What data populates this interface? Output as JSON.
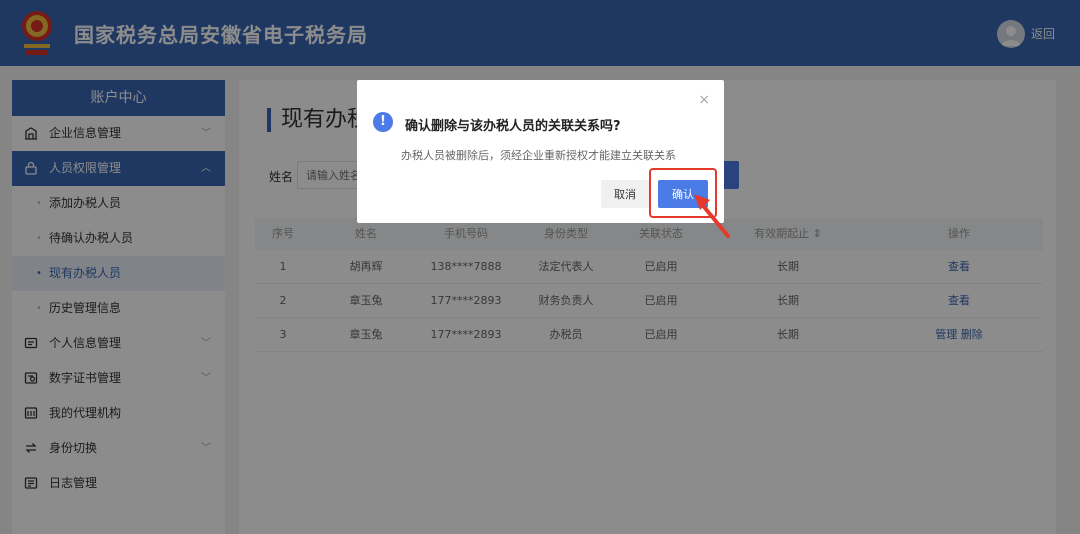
{
  "header": {
    "title": "国家税务总局安徽省电子税务局",
    "back_label": "返回"
  },
  "sidebar": {
    "title": "账户中心",
    "items": [
      {
        "label": "企业信息管理",
        "icon": "building-icon",
        "chevron": "﹀"
      },
      {
        "label": "人员权限管理",
        "icon": "lock-icon",
        "chevron": "︿"
      },
      {
        "label": "添加办税人员"
      },
      {
        "label": "待确认办税人员"
      },
      {
        "label": "现有办税人员"
      },
      {
        "label": "历史管理信息"
      },
      {
        "label": "个人信息管理",
        "icon": "id-card-icon",
        "chevron": "﹀"
      },
      {
        "label": "数字证书管理",
        "icon": "certificate-icon",
        "chevron": "﹀"
      },
      {
        "label": "我的代理机构",
        "icon": "agency-icon"
      },
      {
        "label": "身份切换",
        "icon": "switch-icon",
        "chevron": "﹀"
      },
      {
        "label": "日志管理",
        "icon": "log-icon"
      }
    ]
  },
  "main": {
    "title": "现有办税人员",
    "filter_label": "姓名",
    "filter_placeholder": "请输入姓名",
    "table": {
      "headers": [
        "序号",
        "姓名",
        "手机号码",
        "身份类型",
        "关联状态",
        "有效期起止 ⇕",
        "操作"
      ],
      "rows": [
        {
          "no": "1",
          "name": "胡再辉",
          "phone": "138****7888",
          "role": "法定代表人",
          "status": "已启用",
          "validity": "长期",
          "actions": [
            "查看"
          ]
        },
        {
          "no": "2",
          "name": "章玉兔",
          "phone": "177****2893",
          "role": "财务负责人",
          "status": "已启用",
          "validity": "长期",
          "actions": [
            "查看"
          ]
        },
        {
          "no": "3",
          "name": "章玉兔",
          "phone": "177****2893",
          "role": "办税员",
          "status": "已启用",
          "validity": "长期",
          "actions": [
            "管理",
            "删除"
          ]
        }
      ]
    }
  },
  "dialog": {
    "title": "确认删除与该办税人员的关联关系吗?",
    "message": "办税人员被删除后，须经企业重新授权才能建立关联关系",
    "cancel_label": "取消",
    "confirm_label": "确认",
    "close_icon": "×",
    "warn_icon": "!"
  },
  "colors": {
    "primary": "#3a66b3",
    "button": "#4b7be6",
    "highlight": "#e53a2b"
  }
}
